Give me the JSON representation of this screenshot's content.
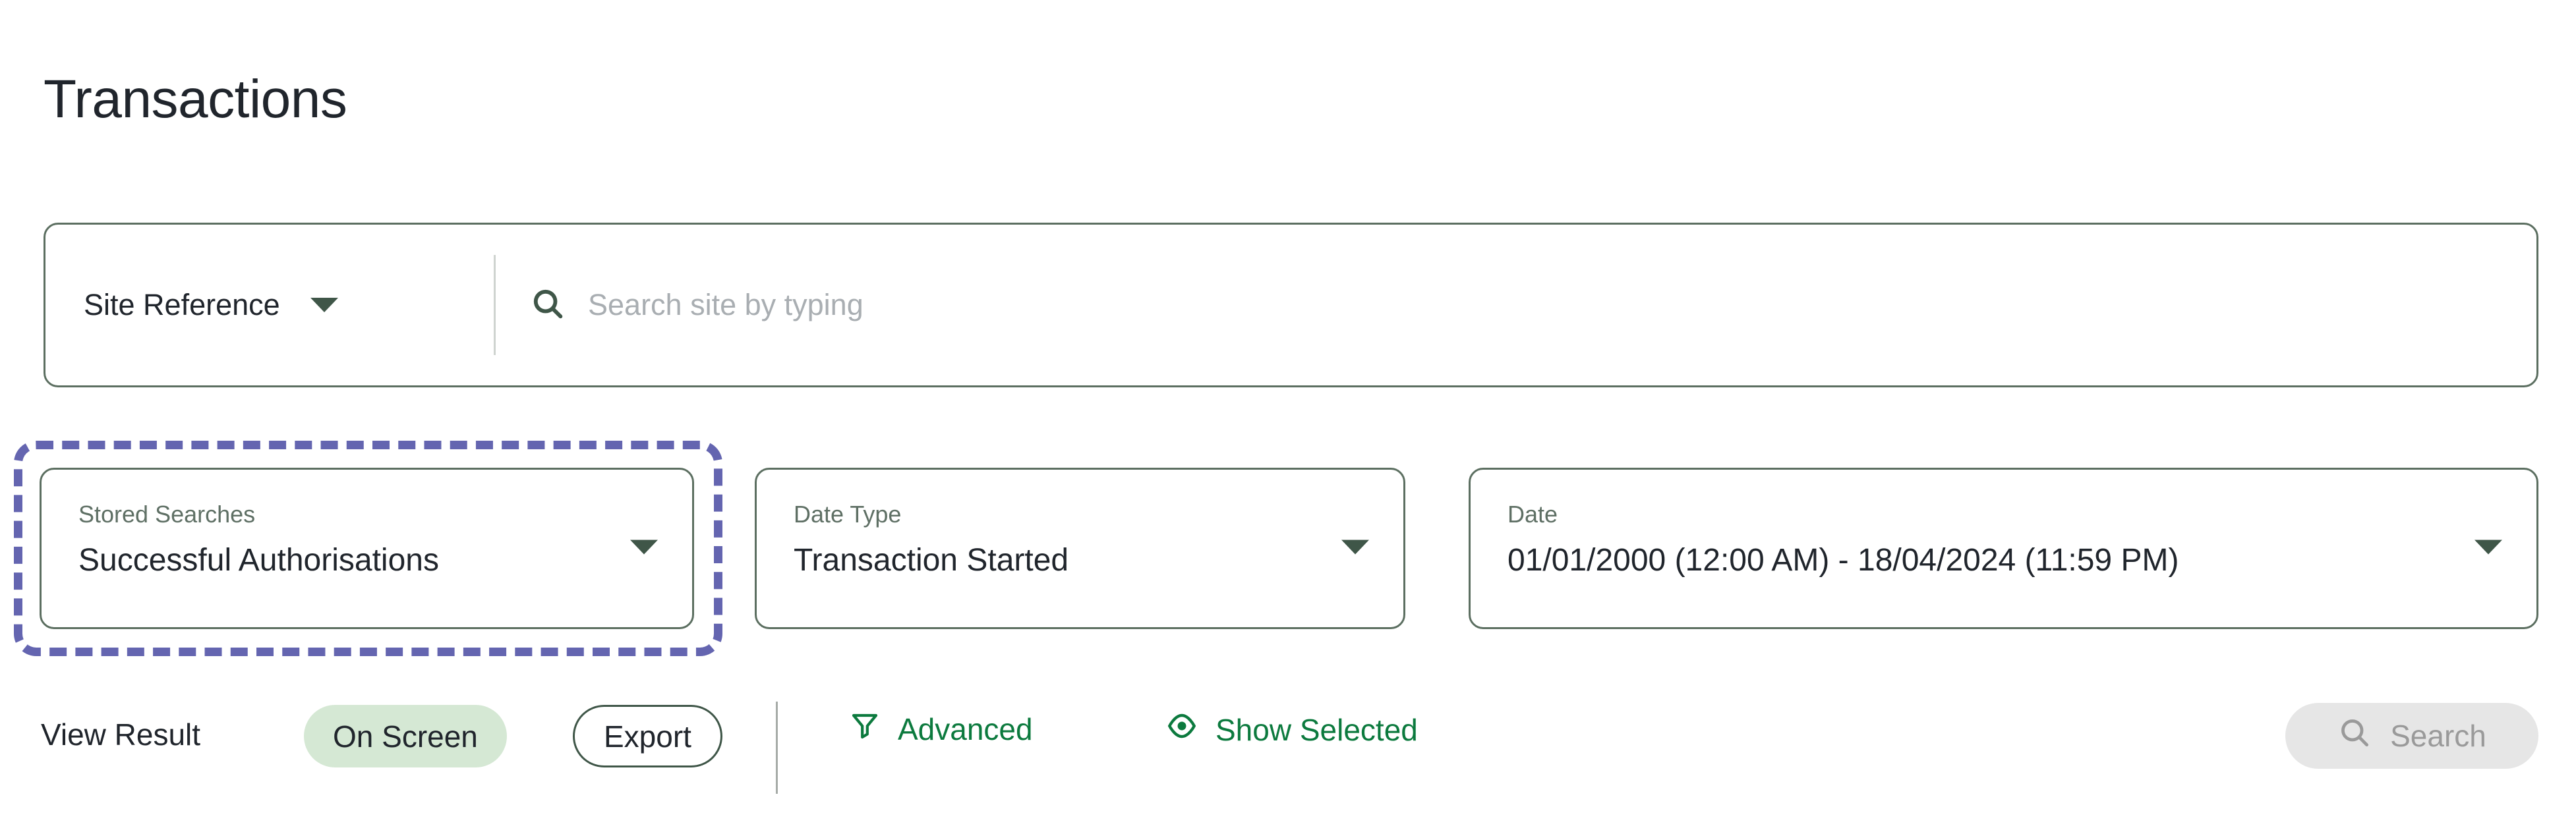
{
  "page": {
    "title": "Transactions"
  },
  "site_search": {
    "type_select": {
      "value": "Site Reference",
      "caret_icon": "chevron-down-icon"
    },
    "search_icon": "search-icon",
    "input": {
      "value": "",
      "placeholder": "Search site by typing"
    }
  },
  "filters": [
    {
      "label": "Stored Searches",
      "value": "Successful Authorisations",
      "caret_icon": "chevron-down-icon",
      "highlighted": true
    },
    {
      "label": "Date Type",
      "value": "Transaction Started",
      "caret_icon": "chevron-down-icon",
      "highlighted": false
    },
    {
      "label": "Date",
      "value": "01/01/2000 (12:00 AM) - 18/04/2024 (11:59 PM)",
      "caret_icon": "chevron-down-icon",
      "highlighted": false
    }
  ],
  "toolbar": {
    "view_result_label": "View Result",
    "on_screen_label": "On Screen",
    "export_label": "Export",
    "advanced_label": "Advanced",
    "advanced_icon": "filter-funnel-icon",
    "show_selected_label": "Show Selected",
    "show_selected_icon": "eye-icon",
    "search_label": "Search",
    "search_icon": "search-icon"
  },
  "colors": {
    "field_border": "#5c6f61",
    "accent_green": "#0c7a3e",
    "caret_green": "#3f5648",
    "highlight_purple": "#6465b0",
    "on_screen_pill": "#d5e8d4",
    "disabled_button_bg": "#e6e6e6",
    "disabled_button_text": "#9a9a9a",
    "label_text": "#5f7065",
    "placeholder_text": "#a9aeb2",
    "body_text": "#20252c"
  }
}
